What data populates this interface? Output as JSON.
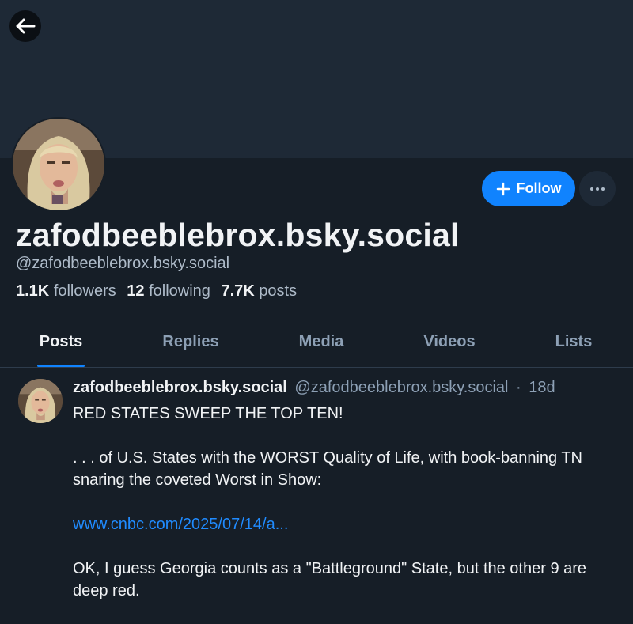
{
  "header": {
    "back_icon": "arrow-left-icon"
  },
  "profile": {
    "display_name": "zafodbeeblebrox.bsky.social",
    "handle": "@zafodbeeblebrox.bsky.social",
    "follow_label": "Follow",
    "follow_icon": "plus-icon",
    "more_icon": "ellipsis-icon",
    "stats": {
      "followers_count": "1.1K",
      "followers_label": "followers",
      "following_count": "12",
      "following_label": "following",
      "posts_count": "7.7K",
      "posts_label": "posts"
    }
  },
  "tabs": [
    {
      "label": "Posts",
      "active": true
    },
    {
      "label": "Replies",
      "active": false
    },
    {
      "label": "Media",
      "active": false
    },
    {
      "label": "Videos",
      "active": false
    },
    {
      "label": "Lists",
      "active": false
    }
  ],
  "post": {
    "author": "zafodbeeblebrox.bsky.social",
    "handle": "@zafodbeeblebrox.bsky.social",
    "separator": "·",
    "time": "18d",
    "line1": "RED STATES SWEEP THE TOP TEN!",
    "line2": ". . . of U.S. States with the WORST Quality of Life, with book-banning TN snaring the coveted Worst in Show:",
    "link": "www.cnbc.com/2025/07/14/a...",
    "line3": "OK, I guess Georgia counts as a \"Battleground\" State, but the other 9 are deep red."
  },
  "colors": {
    "accent": "#1083fe",
    "background": "#161e27",
    "banner": "#1e2936",
    "muted_text": "#8da0b5"
  }
}
